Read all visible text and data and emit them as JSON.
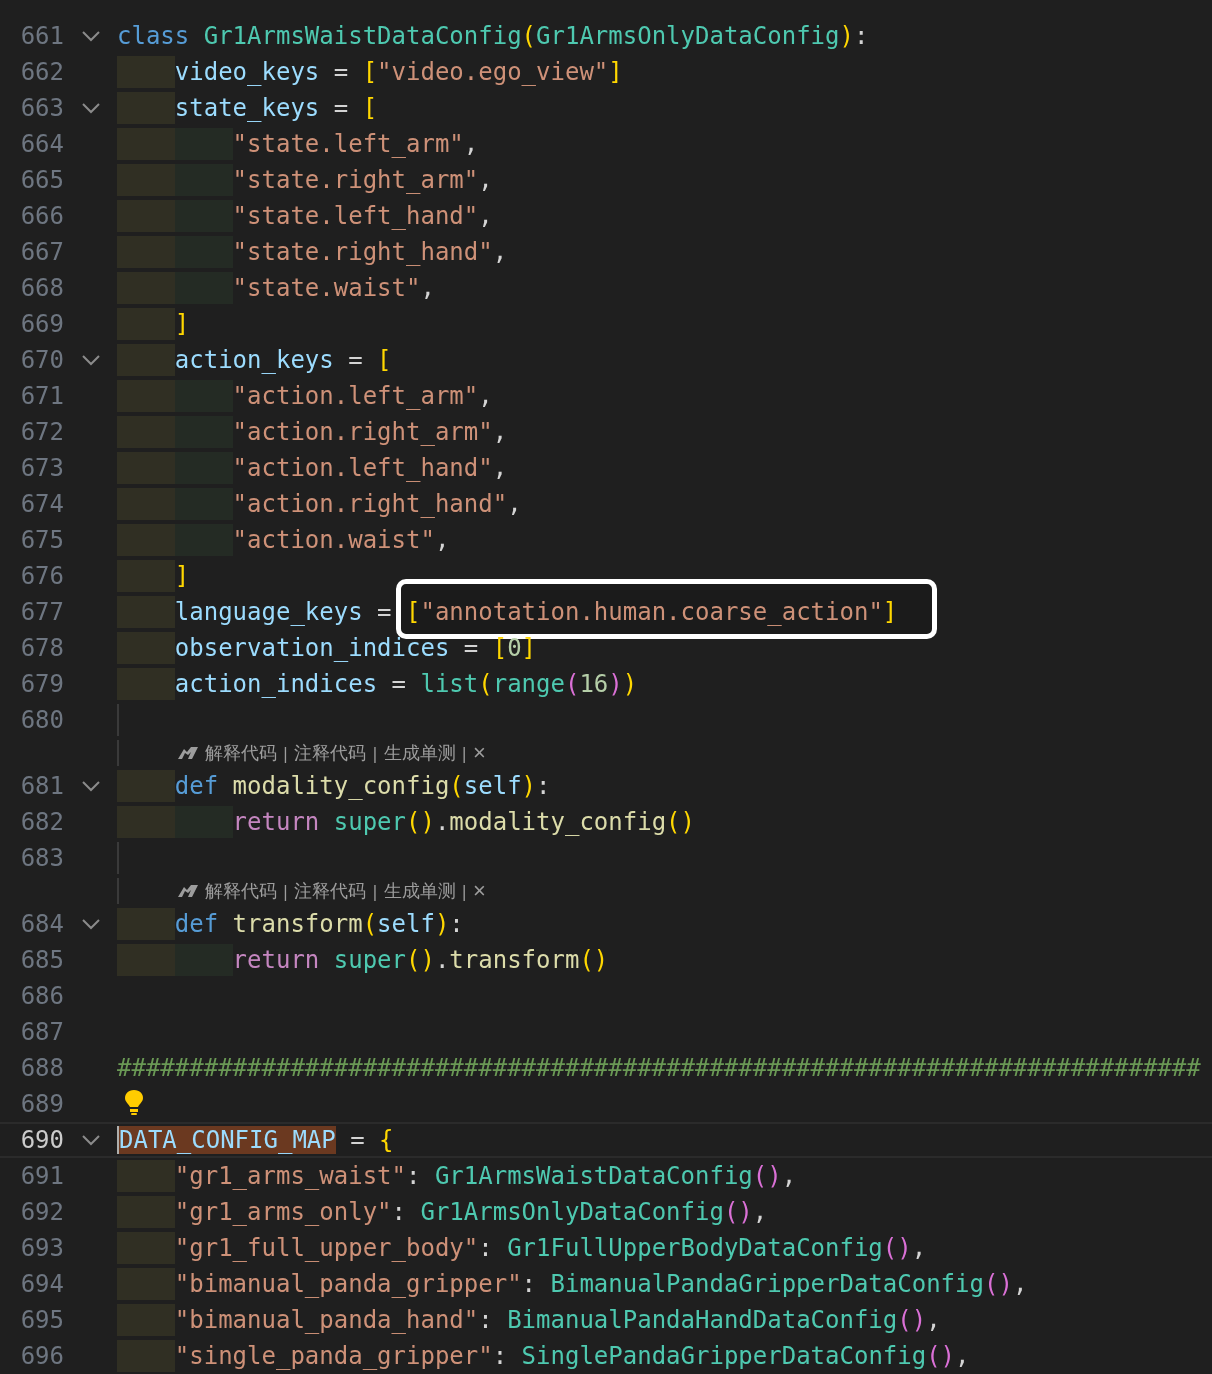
{
  "editor": {
    "lines": [
      {
        "kind": "code",
        "number": "661",
        "fold": true,
        "tokens": [
          {
            "text": "class ",
            "kind": "kw"
          },
          {
            "text": "Gr1ArmsWaistDataConfig",
            "kind": "cls"
          },
          {
            "text": "(",
            "kind": "br1"
          },
          {
            "text": "Gr1ArmsOnlyDataConfig",
            "kind": "cls"
          },
          {
            "text": ")",
            "kind": "br1"
          },
          {
            "text": ":",
            "kind": "op"
          }
        ]
      },
      {
        "kind": "code",
        "number": "662",
        "guides": [
          {
            "kind": "outer"
          }
        ],
        "tokens": [
          {
            "text": "video_keys",
            "kind": "var"
          },
          {
            "text": " = ",
            "kind": "op"
          },
          {
            "text": "[",
            "kind": "br1"
          },
          {
            "text": "\"video.ego_view\"",
            "kind": "str"
          },
          {
            "text": "]",
            "kind": "br1"
          }
        ]
      },
      {
        "kind": "code",
        "number": "663",
        "fold": true,
        "guides": [
          {
            "kind": "outer"
          }
        ],
        "tokens": [
          {
            "text": "state_keys",
            "kind": "var"
          },
          {
            "text": " = ",
            "kind": "op"
          },
          {
            "text": "[",
            "kind": "br1"
          }
        ]
      },
      {
        "kind": "code",
        "number": "664",
        "guides": [
          {
            "kind": "outer"
          },
          {
            "kind": "inner"
          }
        ],
        "tokens": [
          {
            "text": "\"state.left_arm\"",
            "kind": "str"
          },
          {
            "text": ",",
            "kind": "op"
          }
        ]
      },
      {
        "kind": "code",
        "number": "665",
        "guides": [
          {
            "kind": "outer"
          },
          {
            "kind": "inner"
          }
        ],
        "tokens": [
          {
            "text": "\"state.right_arm\"",
            "kind": "str"
          },
          {
            "text": ",",
            "kind": "op"
          }
        ]
      },
      {
        "kind": "code",
        "number": "666",
        "guides": [
          {
            "kind": "outer"
          },
          {
            "kind": "inner"
          }
        ],
        "tokens": [
          {
            "text": "\"state.left_hand\"",
            "kind": "str"
          },
          {
            "text": ",",
            "kind": "op"
          }
        ]
      },
      {
        "kind": "code",
        "number": "667",
        "guides": [
          {
            "kind": "outer"
          },
          {
            "kind": "inner"
          }
        ],
        "tokens": [
          {
            "text": "\"state.right_hand\"",
            "kind": "str"
          },
          {
            "text": ",",
            "kind": "op"
          }
        ]
      },
      {
        "kind": "code",
        "number": "668",
        "guides": [
          {
            "kind": "outer"
          },
          {
            "kind": "inner"
          }
        ],
        "tokens": [
          {
            "text": "\"state.waist\"",
            "kind": "str"
          },
          {
            "text": ",",
            "kind": "op"
          }
        ]
      },
      {
        "kind": "code",
        "number": "669",
        "guides": [
          {
            "kind": "outer"
          }
        ],
        "tokens": [
          {
            "text": "]",
            "kind": "br1"
          }
        ]
      },
      {
        "kind": "code",
        "number": "670",
        "fold": true,
        "guides": [
          {
            "kind": "outer"
          }
        ],
        "tokens": [
          {
            "text": "action_keys",
            "kind": "var"
          },
          {
            "text": " = ",
            "kind": "op"
          },
          {
            "text": "[",
            "kind": "br1"
          }
        ]
      },
      {
        "kind": "code",
        "number": "671",
        "guides": [
          {
            "kind": "outer"
          },
          {
            "kind": "inner"
          }
        ],
        "tokens": [
          {
            "text": "\"action.left_arm\"",
            "kind": "str"
          },
          {
            "text": ",",
            "kind": "op"
          }
        ]
      },
      {
        "kind": "code",
        "number": "672",
        "guides": [
          {
            "kind": "outer"
          },
          {
            "kind": "inner"
          }
        ],
        "tokens": [
          {
            "text": "\"action.right_arm\"",
            "kind": "str"
          },
          {
            "text": ",",
            "kind": "op"
          }
        ]
      },
      {
        "kind": "code",
        "number": "673",
        "guides": [
          {
            "kind": "outer"
          },
          {
            "kind": "inner"
          }
        ],
        "tokens": [
          {
            "text": "\"action.left_hand\"",
            "kind": "str"
          },
          {
            "text": ",",
            "kind": "op"
          }
        ]
      },
      {
        "kind": "code",
        "number": "674",
        "guides": [
          {
            "kind": "outer"
          },
          {
            "kind": "inner"
          }
        ],
        "tokens": [
          {
            "text": "\"action.right_hand\"",
            "kind": "str"
          },
          {
            "text": ",",
            "kind": "op"
          }
        ]
      },
      {
        "kind": "code",
        "number": "675",
        "guides": [
          {
            "kind": "outer"
          },
          {
            "kind": "inner"
          }
        ],
        "tokens": [
          {
            "text": "\"action.waist\"",
            "kind": "str"
          },
          {
            "text": ",",
            "kind": "op"
          }
        ]
      },
      {
        "kind": "code",
        "number": "676",
        "guides": [
          {
            "kind": "outer"
          }
        ],
        "tokens": [
          {
            "text": "]",
            "kind": "br1"
          }
        ]
      },
      {
        "kind": "code",
        "number": "677",
        "guides": [
          {
            "kind": "outer"
          }
        ],
        "tokens": [
          {
            "text": "language_keys",
            "kind": "var"
          },
          {
            "text": " = ",
            "kind": "op"
          },
          {
            "text": "[",
            "kind": "br1",
            "framed": true
          },
          {
            "text": "\"annotation.human.coarse_action\"",
            "kind": "str",
            "framed": true
          },
          {
            "text": "]",
            "kind": "br1",
            "framed": true
          }
        ]
      },
      {
        "kind": "code",
        "number": "678",
        "guides": [
          {
            "kind": "outer"
          }
        ],
        "tokens": [
          {
            "text": "observation_indices",
            "kind": "var"
          },
          {
            "text": " = ",
            "kind": "op"
          },
          {
            "text": "[",
            "kind": "br1"
          },
          {
            "text": "0",
            "kind": "num"
          },
          {
            "text": "]",
            "kind": "br1"
          }
        ]
      },
      {
        "kind": "code",
        "number": "679",
        "guides": [
          {
            "kind": "outer"
          }
        ],
        "tokens": [
          {
            "text": "action_indices",
            "kind": "var"
          },
          {
            "text": " = ",
            "kind": "op"
          },
          {
            "text": "list",
            "kind": "cls"
          },
          {
            "text": "(",
            "kind": "br1"
          },
          {
            "text": "range",
            "kind": "cls"
          },
          {
            "text": "(",
            "kind": "br2"
          },
          {
            "text": "16",
            "kind": "num"
          },
          {
            "text": ")",
            "kind": "br2"
          },
          {
            "text": ")",
            "kind": "br1"
          }
        ]
      },
      {
        "kind": "code",
        "number": "680",
        "guide": true
      },
      {
        "kind": "codelens",
        "guide": true,
        "actions": [
          "解释代码",
          "注释代码",
          "生成单测"
        ],
        "separator": "|",
        "close": "×"
      },
      {
        "kind": "code",
        "number": "681",
        "fold": true,
        "guides": [
          {
            "kind": "outer"
          }
        ],
        "tokens": [
          {
            "text": "def ",
            "kind": "kw"
          },
          {
            "text": "modality_config",
            "kind": "fn"
          },
          {
            "text": "(",
            "kind": "br1"
          },
          {
            "text": "self",
            "kind": "var"
          },
          {
            "text": ")",
            "kind": "br1"
          },
          {
            "text": ":",
            "kind": "op"
          }
        ]
      },
      {
        "kind": "code",
        "number": "682",
        "guides": [
          {
            "kind": "outer"
          },
          {
            "kind": "inner"
          }
        ],
        "tokens": [
          {
            "text": "return ",
            "kind": "ctl"
          },
          {
            "text": "super",
            "kind": "cls"
          },
          {
            "text": "()",
            "kind": "br1"
          },
          {
            "text": ".",
            "kind": "op"
          },
          {
            "text": "modality_config",
            "kind": "fn"
          },
          {
            "text": "()",
            "kind": "br1"
          }
        ]
      },
      {
        "kind": "code",
        "number": "683",
        "guide": true
      },
      {
        "kind": "codelens",
        "guide": true,
        "actions": [
          "解释代码",
          "注释代码",
          "生成单测"
        ],
        "separator": "|",
        "close": "×"
      },
      {
        "kind": "code",
        "number": "684",
        "fold": true,
        "guides": [
          {
            "kind": "outer"
          }
        ],
        "tokens": [
          {
            "text": "def ",
            "kind": "kw"
          },
          {
            "text": "transform",
            "kind": "fn"
          },
          {
            "text": "(",
            "kind": "br1"
          },
          {
            "text": "self",
            "kind": "var"
          },
          {
            "text": ")",
            "kind": "br1"
          },
          {
            "text": ":",
            "kind": "op"
          }
        ]
      },
      {
        "kind": "code",
        "number": "685",
        "guides": [
          {
            "kind": "outer"
          },
          {
            "kind": "inner"
          }
        ],
        "tokens": [
          {
            "text": "return ",
            "kind": "ctl"
          },
          {
            "text": "super",
            "kind": "cls"
          },
          {
            "text": "()",
            "kind": "br1"
          },
          {
            "text": ".",
            "kind": "op"
          },
          {
            "text": "transform",
            "kind": "fn"
          },
          {
            "text": "()",
            "kind": "br1"
          }
        ]
      },
      {
        "kind": "code",
        "number": "686"
      },
      {
        "kind": "code",
        "number": "687"
      },
      {
        "kind": "code",
        "number": "688",
        "tokens": [
          {
            "text": "###########################################################################",
            "kind": "cmt"
          }
        ]
      },
      {
        "kind": "code",
        "number": "689",
        "lightbulb": true
      },
      {
        "kind": "code",
        "number": "690",
        "fold": true,
        "current": true,
        "tokens": [
          {
            "text": "DATA_CONFIG_MAP",
            "kind": "var_hl"
          },
          {
            "text": " = ",
            "kind": "op"
          },
          {
            "text": "{",
            "kind": "br1"
          }
        ]
      },
      {
        "kind": "code",
        "number": "691",
        "guides": [
          {
            "kind": "outer"
          }
        ],
        "tokens": [
          {
            "text": "\"gr1_arms_waist\"",
            "kind": "str"
          },
          {
            "text": ": ",
            "kind": "op"
          },
          {
            "text": "Gr1ArmsWaistDataConfig",
            "kind": "cls"
          },
          {
            "text": "()",
            "kind": "br2"
          },
          {
            "text": ",",
            "kind": "op"
          }
        ]
      },
      {
        "kind": "code",
        "number": "692",
        "guides": [
          {
            "kind": "outer"
          }
        ],
        "tokens": [
          {
            "text": "\"gr1_arms_only\"",
            "kind": "str"
          },
          {
            "text": ": ",
            "kind": "op"
          },
          {
            "text": "Gr1ArmsOnlyDataConfig",
            "kind": "cls"
          },
          {
            "text": "()",
            "kind": "br2"
          },
          {
            "text": ",",
            "kind": "op"
          }
        ]
      },
      {
        "kind": "code",
        "number": "693",
        "guides": [
          {
            "kind": "outer"
          }
        ],
        "tokens": [
          {
            "text": "\"gr1_full_upper_body\"",
            "kind": "str"
          },
          {
            "text": ": ",
            "kind": "op"
          },
          {
            "text": "Gr1FullUpperBodyDataConfig",
            "kind": "cls"
          },
          {
            "text": "()",
            "kind": "br2"
          },
          {
            "text": ",",
            "kind": "op"
          }
        ]
      },
      {
        "kind": "code",
        "number": "694",
        "guides": [
          {
            "kind": "outer"
          }
        ],
        "tokens": [
          {
            "text": "\"bimanual_panda_gripper\"",
            "kind": "str"
          },
          {
            "text": ": ",
            "kind": "op"
          },
          {
            "text": "BimanualPandaGripperDataConfig",
            "kind": "cls"
          },
          {
            "text": "()",
            "kind": "br2"
          },
          {
            "text": ",",
            "kind": "op"
          }
        ]
      },
      {
        "kind": "code",
        "number": "695",
        "guides": [
          {
            "kind": "outer"
          }
        ],
        "tokens": [
          {
            "text": "\"bimanual_panda_hand\"",
            "kind": "str"
          },
          {
            "text": ": ",
            "kind": "op"
          },
          {
            "text": "BimanualPandaHandDataConfig",
            "kind": "cls"
          },
          {
            "text": "()",
            "kind": "br2"
          },
          {
            "text": ",",
            "kind": "op"
          }
        ]
      },
      {
        "kind": "code",
        "number": "696",
        "guides": [
          {
            "kind": "outer"
          }
        ],
        "tokens": [
          {
            "text": "\"single_panda_gripper\"",
            "kind": "str"
          },
          {
            "text": ": ",
            "kind": "op"
          },
          {
            "text": "SinglePandaGripperDataConfig",
            "kind": "cls"
          },
          {
            "text": "()",
            "kind": "br2"
          },
          {
            "text": ",",
            "kind": "op"
          }
        ]
      }
    ]
  }
}
